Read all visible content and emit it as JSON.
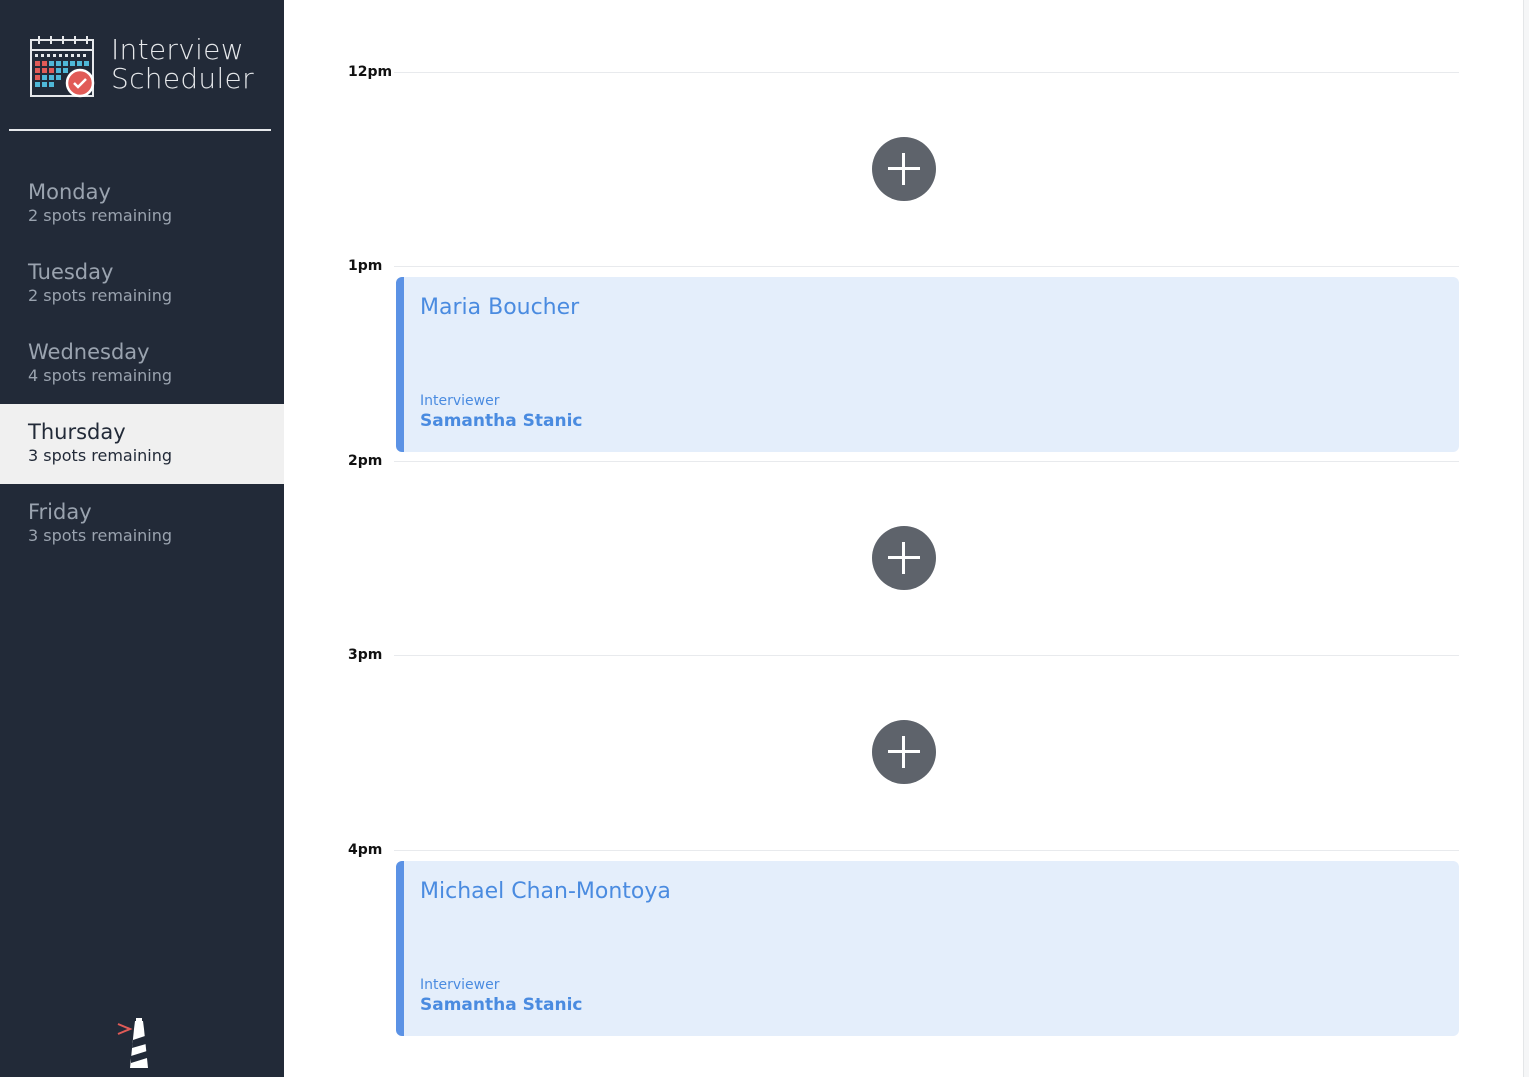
{
  "app": {
    "title_line1": "Interview",
    "title_line2": "Scheduler"
  },
  "sidebar": {
    "days": [
      {
        "name": "Monday",
        "spots": "2 spots remaining",
        "selected": false
      },
      {
        "name": "Tuesday",
        "spots": "2 spots remaining",
        "selected": false
      },
      {
        "name": "Wednesday",
        "spots": "4 spots remaining",
        "selected": false
      },
      {
        "name": "Thursday",
        "spots": "3 spots remaining",
        "selected": true
      },
      {
        "name": "Friday",
        "spots": "3 spots remaining",
        "selected": false
      }
    ]
  },
  "schedule": {
    "slots": [
      {
        "time": "12pm",
        "type": "empty"
      },
      {
        "time": "1pm",
        "type": "booked",
        "student": "Maria Boucher",
        "interviewer_label": "Interviewer",
        "interviewer": "Samantha Stanic"
      },
      {
        "time": "2pm",
        "type": "empty"
      },
      {
        "time": "3pm",
        "type": "empty"
      },
      {
        "time": "4pm",
        "type": "booked",
        "student": "Michael Chan-Montoya",
        "interviewer_label": "Interviewer",
        "interviewer": "Samantha Stanic"
      }
    ]
  },
  "icons": {
    "logo": "calendar-check-icon",
    "add": "plus-icon",
    "footer": "lighthouse-icon"
  },
  "colors": {
    "sidebar_bg": "#222a38",
    "selected_bg": "#f0f0f0",
    "appointment_bg": "#e4eefb",
    "accent": "#5b92e5",
    "add_button": "#5e636b"
  }
}
